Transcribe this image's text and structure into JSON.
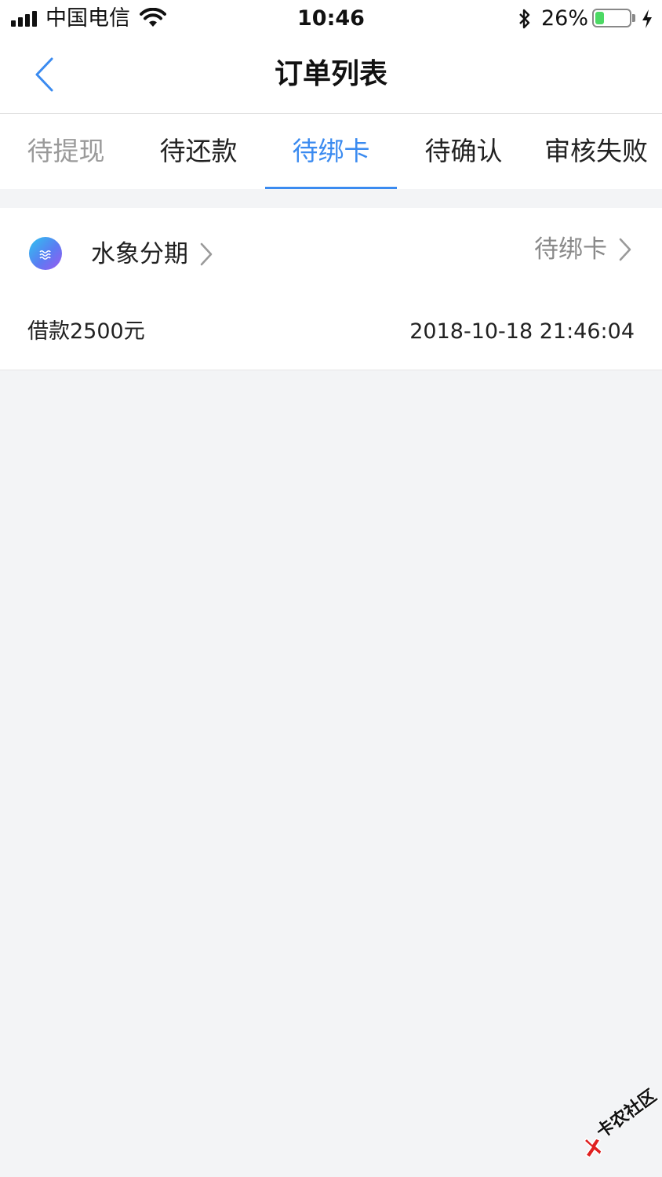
{
  "status_bar": {
    "carrier": "中国电信",
    "time": "10:46",
    "battery_percent": "26%",
    "battery_level": 0.26,
    "icons": [
      "signal-icon",
      "wifi-icon",
      "bluetooth-icon",
      "battery-icon",
      "charging-icon"
    ]
  },
  "nav": {
    "title": "订单列表",
    "back_icon": "chevron-left-icon"
  },
  "tabs": [
    {
      "label": "待提现",
      "state": "faded"
    },
    {
      "label": "待还款",
      "state": "normal"
    },
    {
      "label": "待绑卡",
      "state": "active"
    },
    {
      "label": "待确认",
      "state": "normal"
    },
    {
      "label": "审核失败",
      "state": "normal"
    }
  ],
  "order": {
    "product_name": "水象分期",
    "status": "待绑卡",
    "amount": "借款2500元",
    "datetime": "2018-10-18 21:46:04",
    "logo_icon": "wave-logo-icon"
  },
  "watermark": {
    "text": "卡农社区"
  },
  "colors": {
    "accent": "#3b8bf0",
    "page_bg": "#f3f4f6",
    "muted_text": "#8a8a8a",
    "battery_green": "#4cd964"
  }
}
